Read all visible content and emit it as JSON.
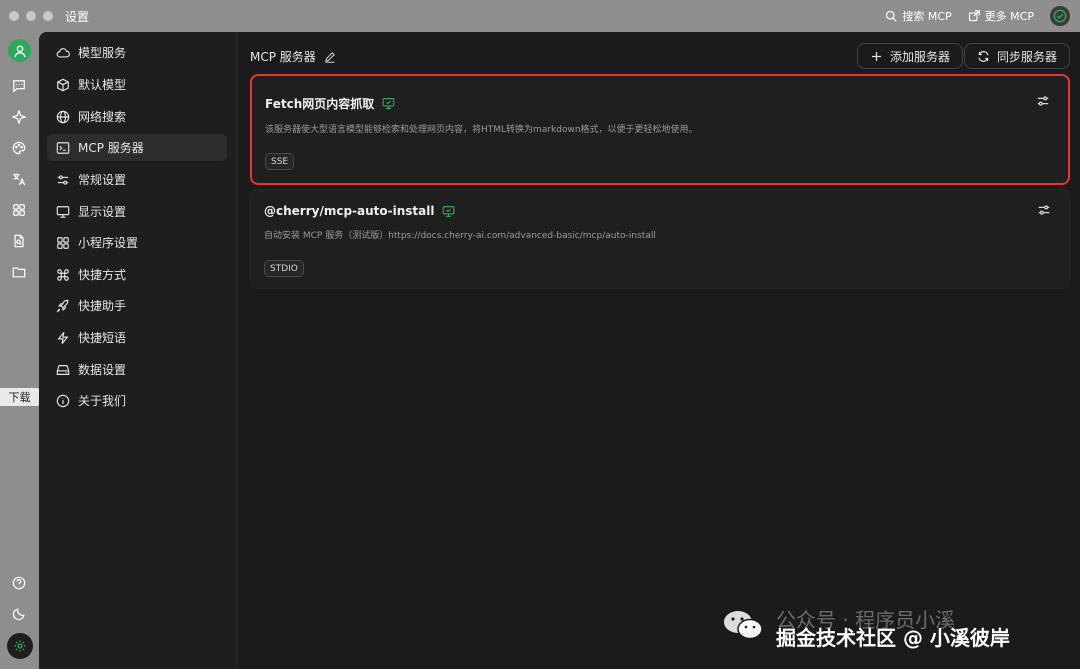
{
  "window": {
    "title": "设置"
  },
  "titlebar": {
    "search_mcp": "搜索 MCP",
    "more_mcp": "更多 MCP"
  },
  "rail": {
    "download_label": "下载"
  },
  "sidebar": {
    "items": [
      {
        "label": "模型服务",
        "icon": "cloud-icon"
      },
      {
        "label": "默认模型",
        "icon": "cube-icon"
      },
      {
        "label": "网络搜索",
        "icon": "globe-icon"
      },
      {
        "label": "MCP 服务器",
        "icon": "terminal-icon",
        "active": true
      },
      {
        "label": "常规设置",
        "icon": "sliders-icon"
      },
      {
        "label": "显示设置",
        "icon": "monitor-icon"
      },
      {
        "label": "小程序设置",
        "icon": "grid-icon"
      },
      {
        "label": "快捷方式",
        "icon": "command-icon"
      },
      {
        "label": "快捷助手",
        "icon": "rocket-icon"
      },
      {
        "label": "快捷短语",
        "icon": "zap-icon"
      },
      {
        "label": "数据设置",
        "icon": "drive-icon"
      },
      {
        "label": "关于我们",
        "icon": "info-icon"
      }
    ]
  },
  "content": {
    "header_title": "MCP 服务器",
    "add_server_label": "添加服务器",
    "sync_server_label": "同步服务器",
    "servers": [
      {
        "name": "Fetch网页内容抓取",
        "description": "该服务器使大型语言模型能够检索和处理网页内容，将HTML转换为markdown格式，以便于更轻松地使用。",
        "transport": "SSE",
        "highlighted": true
      },
      {
        "name": "@cherry/mcp-auto-install",
        "description": "自动安装 MCP 服务（测试版）https://docs.cherry-ai.com/advanced-basic/mcp/auto-install",
        "transport": "STDIO",
        "highlighted": false
      }
    ]
  },
  "watermark": {
    "line1": "公众号 · 程序员小溪",
    "line2": "掘金技术社区 @ 小溪彼岸"
  },
  "colors": {
    "accent_green": "#2ea85a",
    "highlight_red": "#e23535",
    "background": "#1b1b1b"
  }
}
